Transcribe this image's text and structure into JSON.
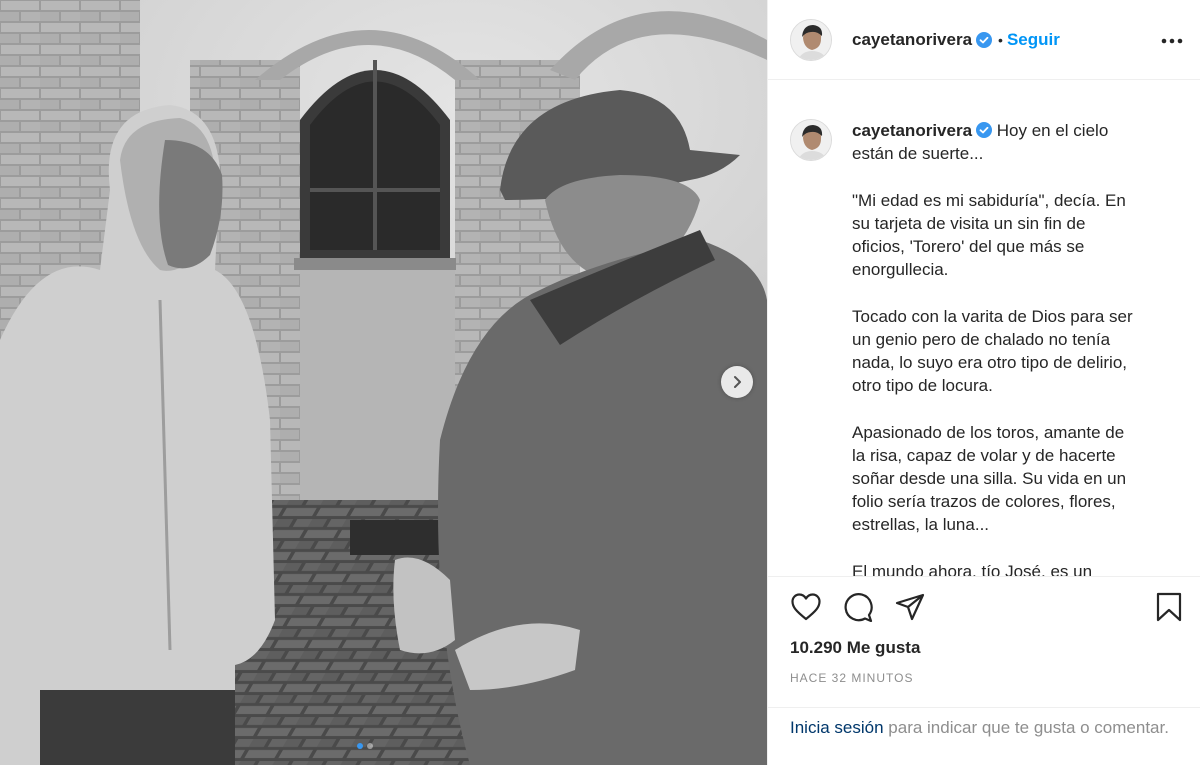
{
  "post": {
    "username": "cayetanorivera",
    "separator": "•",
    "follow_label": "Seguir",
    "caption": "Hoy en el cielo\nestán de suerte...\n\n\"Mi edad es mi sabiduría\", decía. En\nsu tarjeta de visita un sin fin de\noficios, 'Torero' del que más se\nenorgullecia.\n\nTocado con la varita de Dios para ser\nun genio pero de chalado no tenía\nnada, lo suyo era otro tipo de delirio,\notro tipo de locura.\n\nApasionado de los toros, amante de\nla risa, capaz de volar y de hacerte\nsoñar desde una silla. Su vida en un\nfolio sería trazos de colores, flores,\nestrellas, la luna...\n\nEl mundo ahora, tío José, es un",
    "likes": "10.290 Me gusta",
    "time": "HACE 32 MINUTOS",
    "login_link": "Inicia sesión",
    "login_text": " para indicar que te gusta o comentar."
  },
  "icons": {
    "more": "more-options-icon",
    "like": "heart-icon",
    "comment": "comment-icon",
    "share": "share-icon",
    "save": "bookmark-icon",
    "verified": "verified-badge-icon",
    "next": "chevron-right-icon"
  },
  "carousel": {
    "slides": 2,
    "active": 0
  },
  "colors": {
    "accent": "#0095f6",
    "link": "#00376b",
    "verified": "#3897f0",
    "muted": "#8e8e8e"
  }
}
